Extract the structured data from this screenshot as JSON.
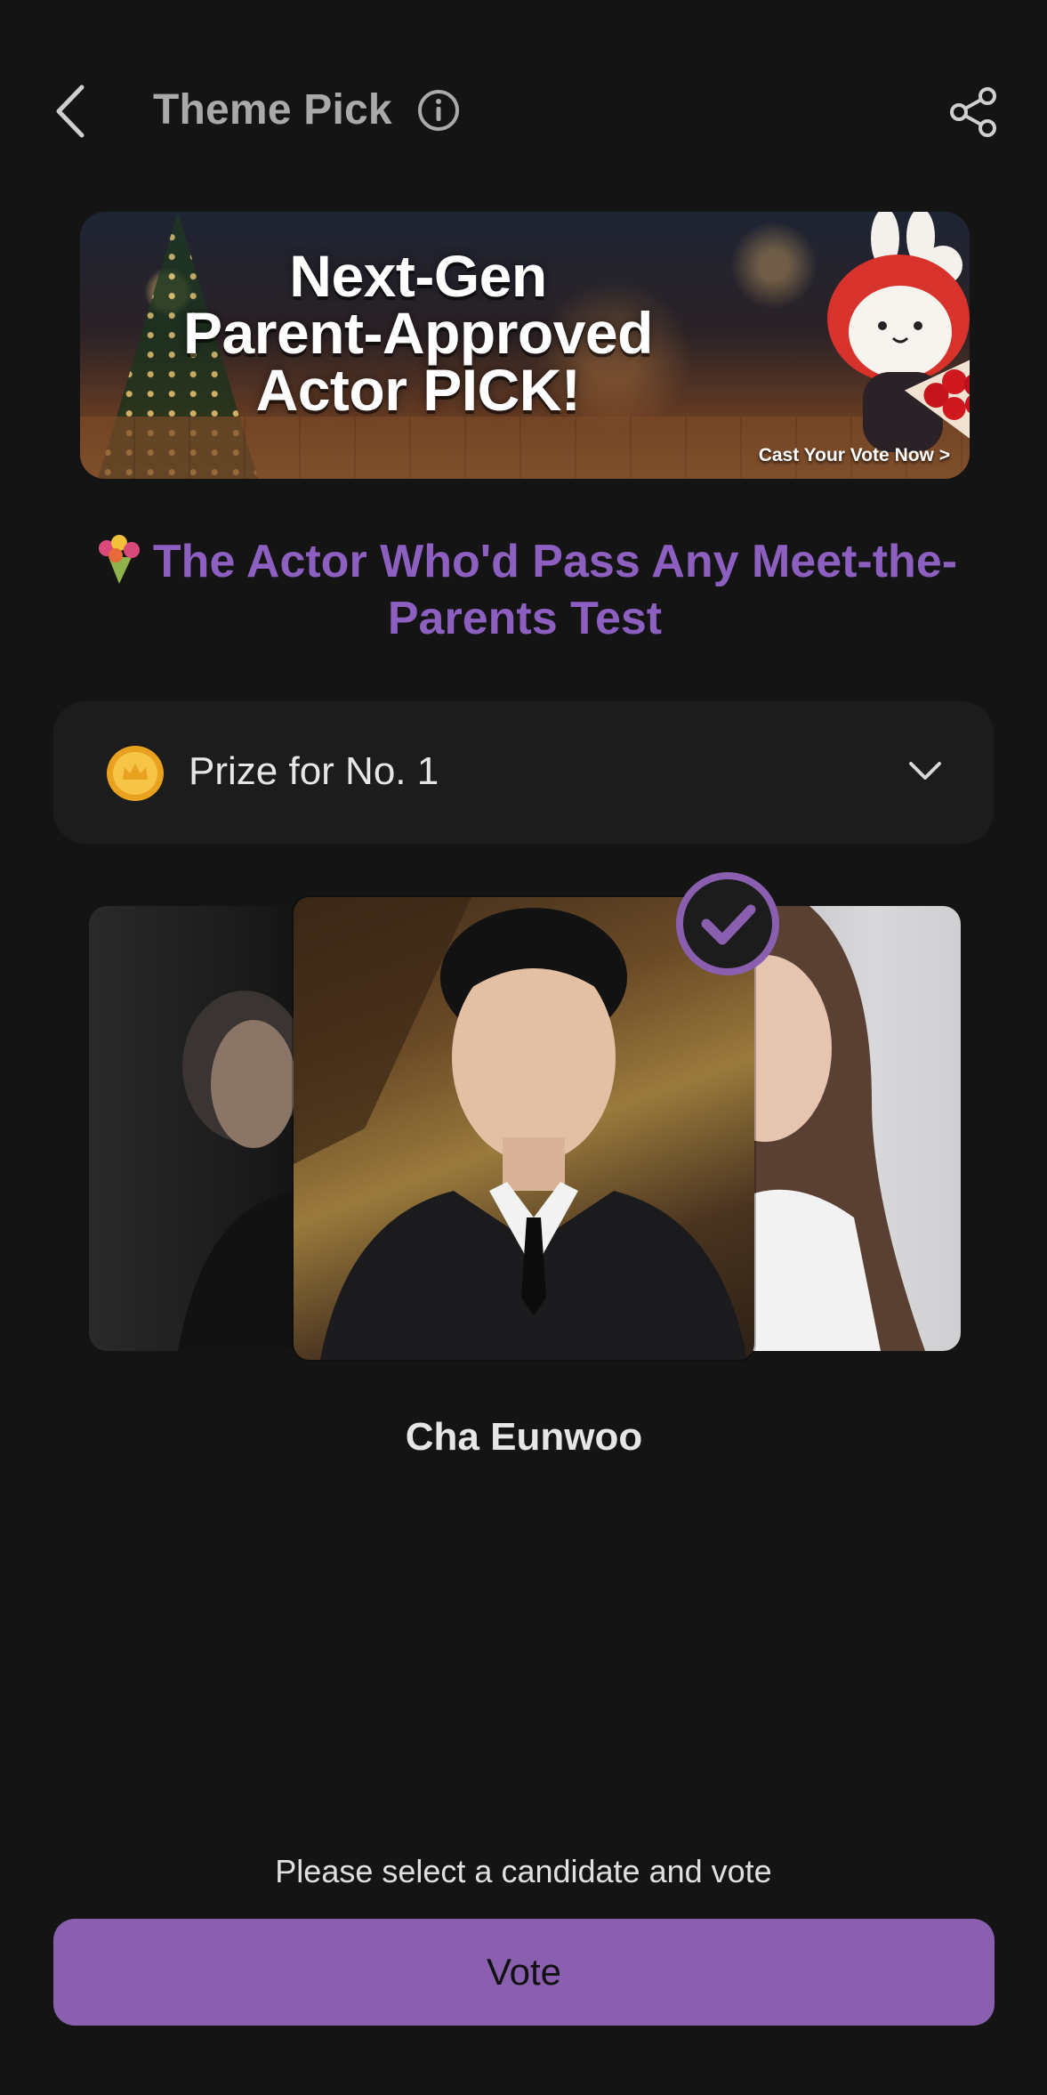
{
  "header": {
    "title": "Theme Pick"
  },
  "banner": {
    "headline_line1": "Next-Gen",
    "headline_line2": "Parent-Approved",
    "headline_line3": "Actor PICK!",
    "cta": "Cast Your Vote Now >"
  },
  "theme": {
    "title": "The Actor Who'd Pass Any Meet-the-Parents Test"
  },
  "prize": {
    "label": "Prize for No. 1"
  },
  "carousel": {
    "selected_candidate": "Cha Eunwoo"
  },
  "footer": {
    "helper_text": "Please select a candidate and vote",
    "vote_label": "Vote"
  },
  "colors": {
    "background": "#141414",
    "accent_purple": "#8d5fc0",
    "vote_button": "#8a5fb0",
    "coin_gold": "#f2b632"
  }
}
